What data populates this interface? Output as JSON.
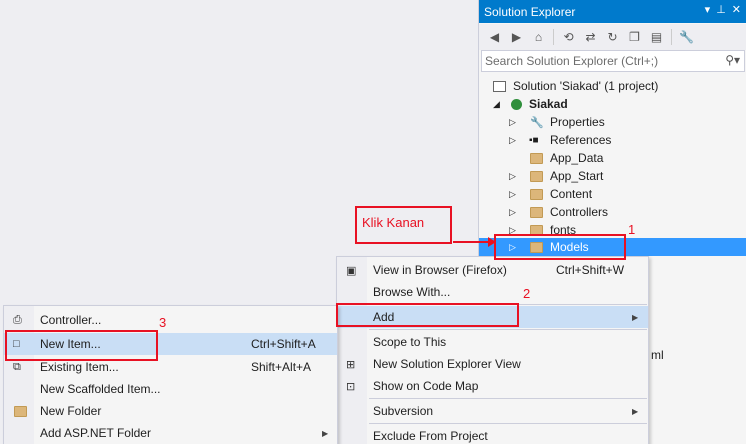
{
  "solution_explorer": {
    "title": "Solution Explorer",
    "search_placeholder": "Search Solution Explorer (Ctrl+;)",
    "solution": "Solution 'Siakad' (1 project)",
    "project": "Siakad",
    "items": [
      "Properties",
      "References",
      "App_Data",
      "App_Start",
      "Content",
      "Controllers",
      "fonts",
      "Models"
    ],
    "partial_text": "ml"
  },
  "context_menu": {
    "items": [
      {
        "label": "View in Browser (Firefox)",
        "shortcut": "Ctrl+Shift+W"
      },
      {
        "label": "Browse With...",
        "shortcut": ""
      },
      {
        "label": "Add",
        "shortcut": ""
      },
      {
        "label": "Scope to This",
        "shortcut": ""
      },
      {
        "label": "New Solution Explorer View",
        "shortcut": ""
      },
      {
        "label": "Show on Code Map",
        "shortcut": ""
      },
      {
        "label": "Subversion",
        "shortcut": ""
      },
      {
        "label": "Exclude From Project",
        "shortcut": ""
      }
    ]
  },
  "add_submenu": {
    "items": [
      {
        "label": "Controller...",
        "shortcut": ""
      },
      {
        "label": "New Item...",
        "shortcut": "Ctrl+Shift+A"
      },
      {
        "label": "Existing Item...",
        "shortcut": "Shift+Alt+A"
      },
      {
        "label": "New Scaffolded Item...",
        "shortcut": ""
      },
      {
        "label": "New Folder",
        "shortcut": ""
      },
      {
        "label": "Add ASP.NET Folder",
        "shortcut": ""
      }
    ]
  },
  "annotations": {
    "klik_kanan": "Klik Kanan",
    "step1": "1",
    "step2": "2",
    "step3": "3"
  },
  "colors": {
    "accent": "#007acc",
    "selection": "#3399ff",
    "highlight": "#c9def5",
    "annotation": "#e81123"
  }
}
